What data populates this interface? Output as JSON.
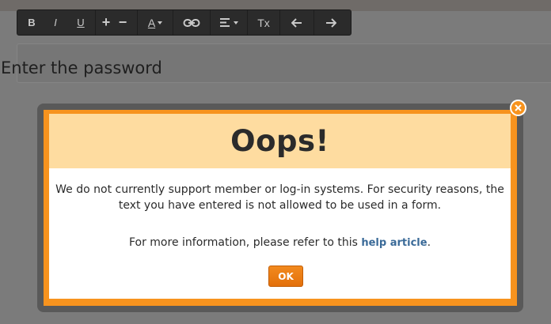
{
  "toolbar": {
    "bold_label": "B",
    "italic_label": "I",
    "underline_label": "U",
    "increase_label": "+",
    "decrease_label": "−",
    "font_color_label": "A",
    "clear_format_label": "Tx",
    "icons": [
      "link-icon",
      "align-icon",
      "undo-icon",
      "redo-icon",
      "chevron-down-icon"
    ]
  },
  "editor": {
    "text": "Enter the password"
  },
  "modal": {
    "title": "Oops!",
    "message": "We do not currently support member or log-in systems. For security reasons, the text you have entered is not allowed to be used in a form.",
    "info_prefix": "For more information, please refer to this ",
    "help_link": "help article",
    "info_suffix": ".",
    "ok_label": "OK",
    "close_icon": "close-icon"
  },
  "colors": {
    "accent": "#f7931e",
    "header_bg": "#fedca0",
    "link": "#3a6a98",
    "toolbar_bg": "#2b2b2b",
    "overlay": "#7b7b7b"
  }
}
